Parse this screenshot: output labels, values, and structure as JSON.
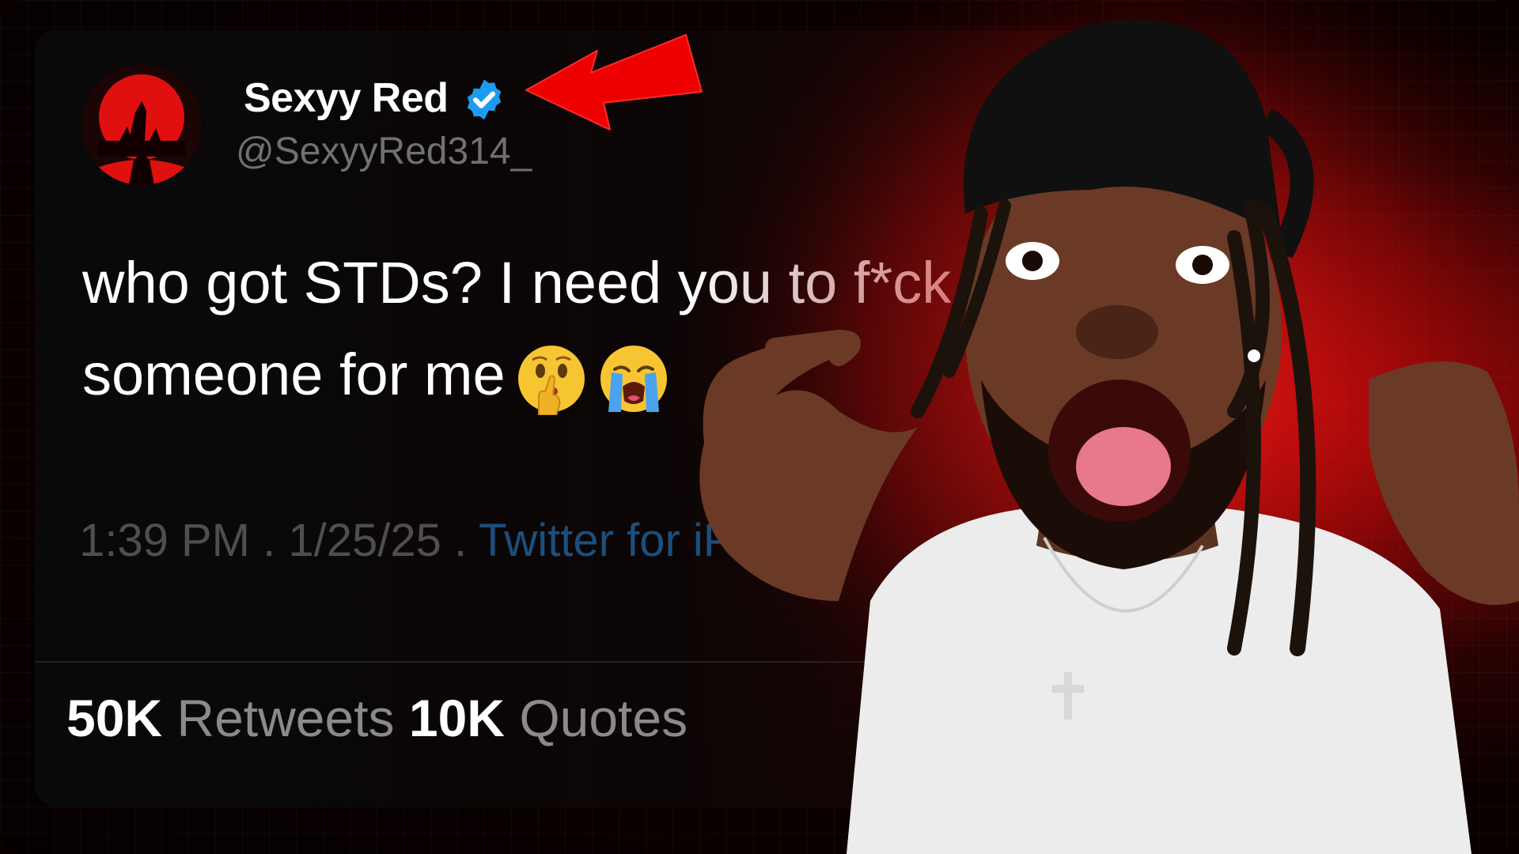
{
  "tweet": {
    "display_name": "Sexyy Red",
    "handle": "@SexyyRed314_",
    "text_line1": "who got STDs? I need you to f*ck",
    "text_line2": "someone for me",
    "emojis": [
      "shushing-face-emoji",
      "loudly-crying-face-emoji"
    ],
    "time": "1:39 PM",
    "date": "1/25/25",
    "separator": " . ",
    "source": "Twitter for iPhone",
    "stats": [
      {
        "count": "50K",
        "label": "Retweets"
      },
      {
        "count": "10K",
        "label": "Quotes"
      }
    ]
  },
  "colors": {
    "accent_red": "#e00000",
    "verified_blue": "#1d9bf0",
    "source_link": "#1b4f7e"
  },
  "icons": {
    "verified": "verified-badge-icon",
    "arrow": "red-arrow-icon"
  }
}
